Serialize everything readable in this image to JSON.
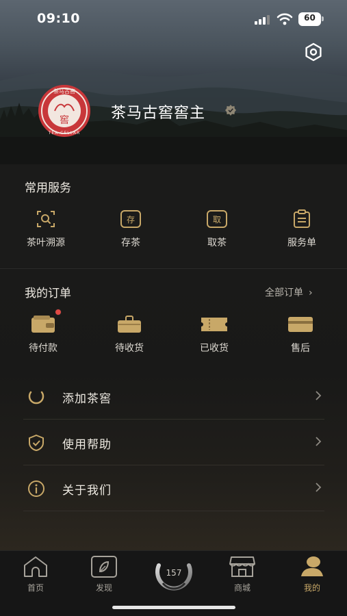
{
  "status_bar": {
    "time": "09:10",
    "battery": "60"
  },
  "profile": {
    "username": "茶马古窖窖主",
    "logo_text": "茶马古窖",
    "logo_subtext": "TEA CELLAR",
    "logo_center": "窖"
  },
  "services": {
    "title": "常用服务",
    "items": [
      {
        "label": "茶叶溯源",
        "icon": "trace-scan-icon"
      },
      {
        "label": "存茶",
        "icon": "store-tea-icon",
        "glyph": "存"
      },
      {
        "label": "取茶",
        "icon": "retrieve-tea-icon",
        "glyph": "取"
      },
      {
        "label": "服务单",
        "icon": "service-order-icon"
      }
    ]
  },
  "orders": {
    "title": "我的订单",
    "all_label": "全部订单",
    "items": [
      {
        "label": "待付款",
        "icon": "wallet-icon",
        "has_badge": true
      },
      {
        "label": "待收货",
        "icon": "bag-icon"
      },
      {
        "label": "已收货",
        "icon": "ticket-icon"
      },
      {
        "label": "售后",
        "icon": "card-icon"
      }
    ]
  },
  "menu": [
    {
      "label": "添加茶窖",
      "icon": "add-cellar-icon"
    },
    {
      "label": "使用帮助",
      "icon": "shield-check-icon"
    },
    {
      "label": "关于我们",
      "icon": "info-icon"
    }
  ],
  "tabs": [
    {
      "label": "首页",
      "icon": "home-icon"
    },
    {
      "label": "发现",
      "icon": "compass-icon"
    },
    {
      "label": "商城",
      "icon": "shop-icon"
    },
    {
      "label": "我的",
      "icon": "profile-icon",
      "active": true
    }
  ],
  "center_tab": {
    "value": "157"
  },
  "colors": {
    "accent_gold": "#c8a868",
    "badge_red": "#e04a44",
    "logo_red": "#c8373a"
  }
}
